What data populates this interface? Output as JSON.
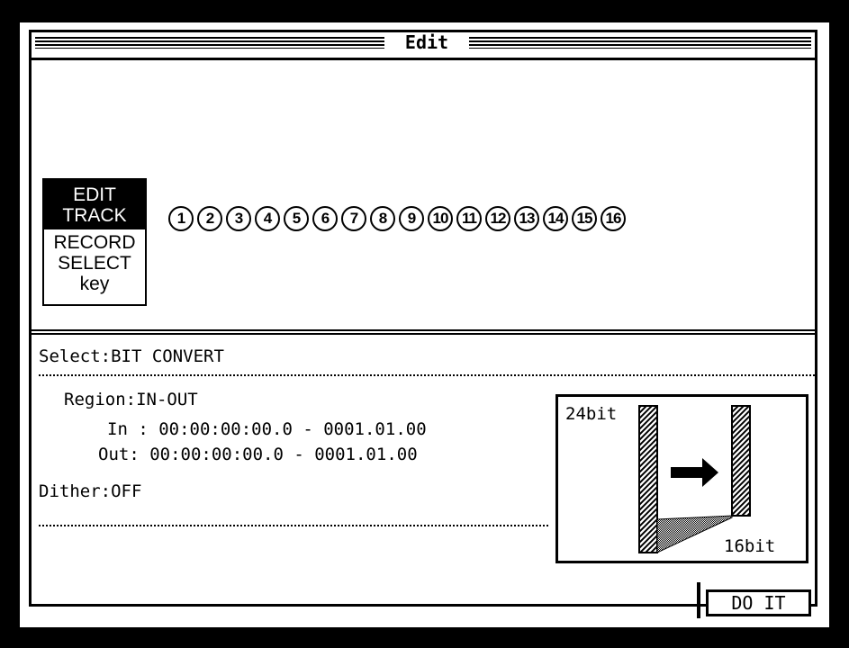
{
  "window": {
    "title": "Edit"
  },
  "key": {
    "line1": "EDIT",
    "line2": "TRACK",
    "line3": "RECORD",
    "line4": "SELECT",
    "line5": "key"
  },
  "tracks": [
    "1",
    "2",
    "3",
    "4",
    "5",
    "6",
    "7",
    "8",
    "9",
    "10",
    "11",
    "12",
    "13",
    "14",
    "15",
    "16"
  ],
  "select": {
    "label": "Select:",
    "value": "BIT CONVERT"
  },
  "region": {
    "label": "Region:",
    "value": "IN-OUT"
  },
  "in": {
    "label": "In :",
    "value": "00:00:00:00.0 - 0001.01.00"
  },
  "out": {
    "label": "Out:",
    "value": "00:00:00:00.0 - 0001.01.00"
  },
  "dither": {
    "label": "Dither:",
    "value": "OFF"
  },
  "diagram": {
    "from_label": "24bit",
    "to_label": "16bit"
  },
  "buttons": {
    "do_it": "DO IT"
  }
}
